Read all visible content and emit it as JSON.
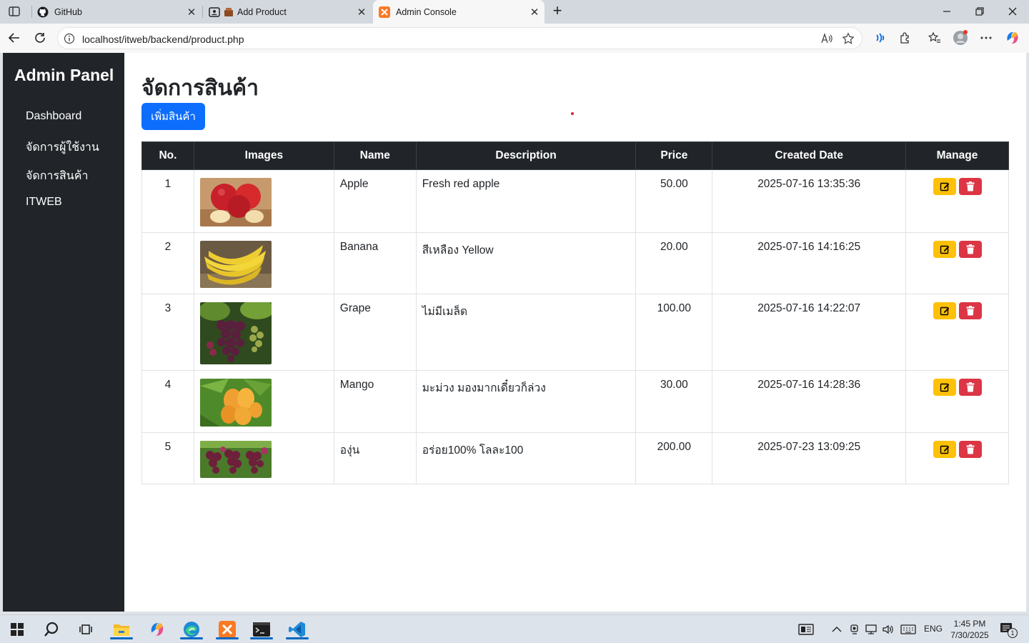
{
  "browser": {
    "tabs": [
      {
        "title": "GitHub",
        "close": "✕"
      },
      {
        "title": "Add Product",
        "close": "✕"
      },
      {
        "title": "Admin Console",
        "close": "✕"
      }
    ],
    "new_tab": "+",
    "url": "localhost/itweb/backend/product.php"
  },
  "sidebar": {
    "brand": "Admin Panel",
    "items": [
      {
        "label": "Dashboard"
      },
      {
        "label": "จัดการผู้ใช้งาน"
      },
      {
        "label": "จัดการสินค้า"
      },
      {
        "label": "ITWEB"
      }
    ]
  },
  "main": {
    "title": "จัดการสินค้า",
    "add_button": "เพิ่มสินค้า"
  },
  "table": {
    "headers": [
      "No.",
      "Images",
      "Name",
      "Description",
      "Price",
      "Created Date",
      "Manage"
    ],
    "rows": [
      {
        "no": "1",
        "image": "apple",
        "name": "Apple",
        "description": "Fresh red apple",
        "price": "50.00",
        "created": "2025-07-16 13:35:36"
      },
      {
        "no": "2",
        "image": "banana",
        "name": "Banana",
        "description": "สีเหลือง Yellow",
        "price": "20.00",
        "created": "2025-07-16 14:16:25"
      },
      {
        "no": "3",
        "image": "grape",
        "name": "Grape",
        "description": "ไม่มีเมล็ด",
        "price": "100.00",
        "created": "2025-07-16 14:22:07"
      },
      {
        "no": "4",
        "image": "mango",
        "name": "Mango",
        "description": "มะม่วง มองมากเดี๋ยวก็ล่วง",
        "price": "30.00",
        "created": "2025-07-16 14:28:36"
      },
      {
        "no": "5",
        "image": "grape-bunch",
        "name": "องุ่น",
        "description": "อร่อย100% โลละ100",
        "price": "200.00",
        "created": "2025-07-23 13:09:25"
      }
    ]
  },
  "taskbar": {
    "language": "ENG",
    "time": "1:45 PM",
    "date": "7/30/2025",
    "notification_count": "1"
  },
  "colors": {
    "sidebar_bg": "#212529",
    "primary": "#0d6efd",
    "warning": "#ffc107",
    "danger": "#dc3545"
  }
}
